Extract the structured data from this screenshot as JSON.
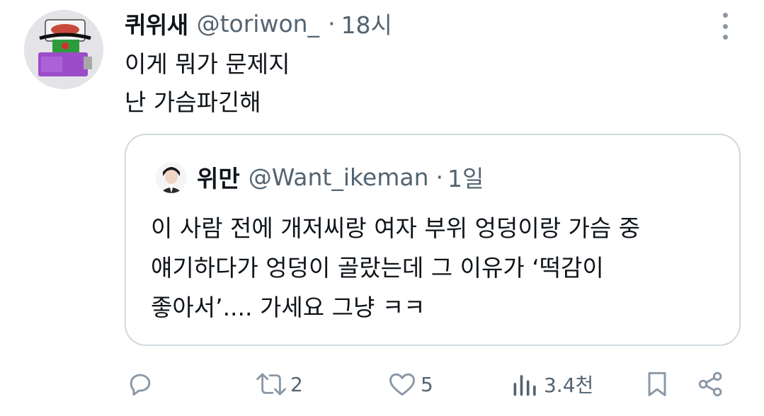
{
  "tweet": {
    "author_name": "퀴위새",
    "handle": "@toriwon_",
    "separator": "·",
    "time": "18시",
    "lines": [
      "이게 뭐가 문제지",
      "난 가슴파긴해"
    ]
  },
  "quote": {
    "author_name": "위만",
    "handle": "@Want_ikeman",
    "separator": "·",
    "time": "1일",
    "lines": [
      "이 사람 전에 개저씨랑 여자 부위 엉덩이랑 가슴 중",
      "얘기하다가 엉덩이 골랐는데 그 이유가 ‘떡감이",
      "좋아서’.... 가세요 그냥 ㅋㅋ"
    ]
  },
  "actions": {
    "reply": {
      "icon": "reply-icon",
      "count": ""
    },
    "retweet": {
      "icon": "retweet-icon",
      "count": "2"
    },
    "like": {
      "icon": "heart-icon",
      "count": "5"
    },
    "views": {
      "icon": "views-icon",
      "count": "3.4천"
    },
    "bookmark": {
      "icon": "bookmark-icon"
    },
    "share": {
      "icon": "share-icon"
    }
  },
  "colors": {
    "text": "#0f1419",
    "secondary": "#536471",
    "border": "#cfd9de",
    "icon": "#8b98a5"
  }
}
